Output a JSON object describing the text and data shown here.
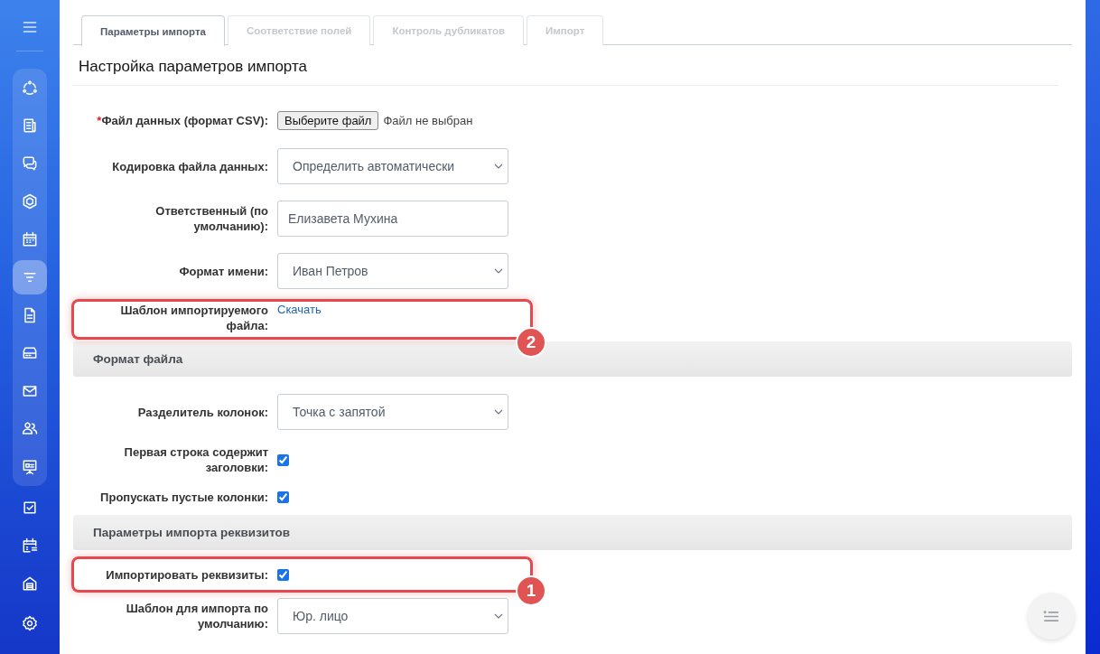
{
  "sidebar": {
    "panel_items": [
      {
        "selected": false
      },
      {
        "selected": false
      },
      {
        "selected": false
      },
      {
        "selected": false
      },
      {
        "selected": false
      },
      {
        "selected": true
      },
      {
        "selected": false
      },
      {
        "selected": false
      },
      {
        "selected": false
      },
      {
        "selected": false
      },
      {
        "selected": false
      }
    ],
    "items": [
      {
        "selected": false
      },
      {
        "selected": false
      },
      {
        "selected": false
      }
    ]
  },
  "tabs": [
    {
      "label": "Параметры импорта",
      "selected": true
    },
    {
      "label": "Соответствие полей",
      "selected": false
    },
    {
      "label": "Контроль дубликатов",
      "selected": false
    },
    {
      "label": "Импорт",
      "selected": false
    }
  ],
  "heading": "Настройка параметров импорта",
  "rows": [
    {
      "kind": "file",
      "required_mark": "*",
      "label": "Файл данных (формат CSV):",
      "button": "Выберите файл",
      "status": "Файл не выбран"
    },
    {
      "kind": "select",
      "label": "Кодировка файла данных:",
      "value": "Определить автоматически"
    },
    {
      "kind": "input",
      "label": "Ответственный (по умолчанию):",
      "value": "Елизавета Мухина"
    },
    {
      "kind": "select",
      "label": "Формат имени:",
      "value": "Иван Петров"
    },
    {
      "kind": "link",
      "label": "Шаблон импортируемого файла:",
      "link": "Скачать",
      "callout": "2"
    },
    {
      "kind": "section",
      "title": "Формат файла"
    },
    {
      "kind": "select",
      "label": "Разделитель колонок:",
      "value": "Точка с запятой"
    },
    {
      "kind": "checkbox",
      "label": "Первая строка содержит заголовки:",
      "checked": true
    },
    {
      "kind": "checkbox",
      "label": "Пропускать пустые колонки:",
      "checked": true
    },
    {
      "kind": "section",
      "title": "Параметры импорта реквизитов"
    },
    {
      "kind": "checkbox",
      "label": "Импортировать реквизиты:",
      "checked": true,
      "callout": "1"
    },
    {
      "kind": "select",
      "label": "Шаблон для импорта по умолчанию:",
      "value": "Юр. лицо"
    }
  ]
}
